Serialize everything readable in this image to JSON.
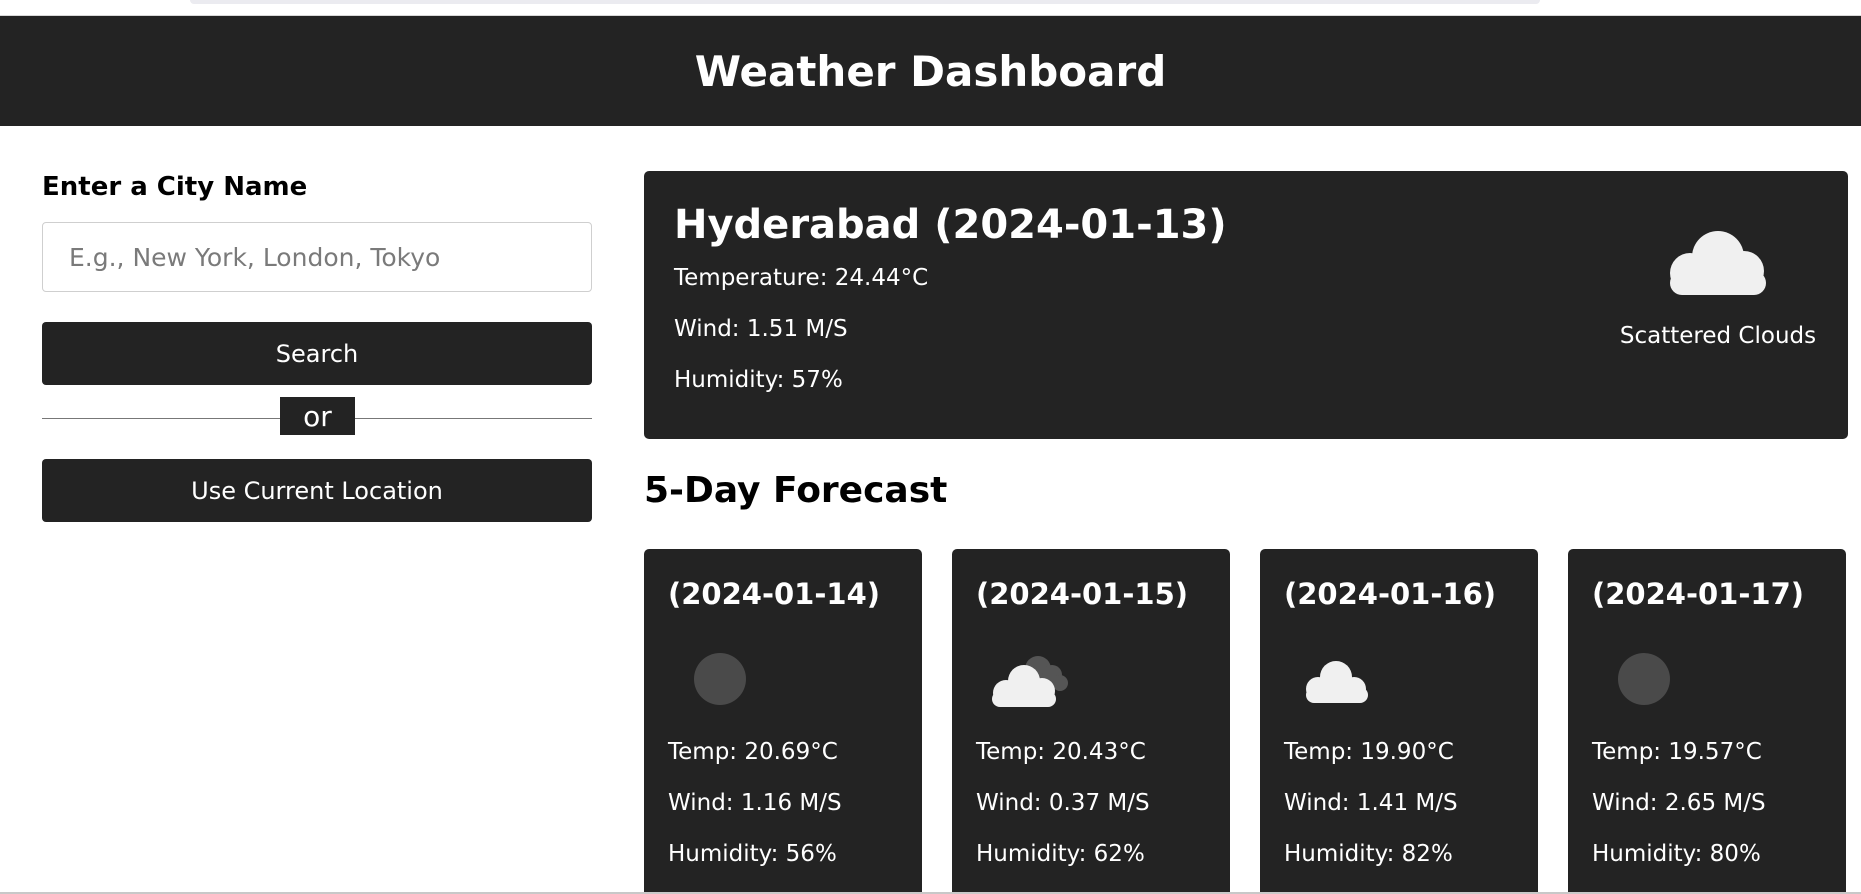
{
  "header": {
    "title": "Weather Dashboard"
  },
  "sidebar": {
    "label": "Enter a City Name",
    "search_placeholder": "E.g., New York, London, Tokyo",
    "search_button": "Search",
    "divider_text": "or",
    "location_button": "Use Current Location"
  },
  "current": {
    "title": "Hyderabad (2024-01-13)",
    "temperature": "Temperature: 24.44°C",
    "wind": "Wind: 1.51 M/S",
    "humidity": "Humidity: 57%",
    "icon": "cloud-icon",
    "description": "Scattered Clouds"
  },
  "forecast": {
    "title": "5-Day Forecast",
    "days": [
      {
        "date": "(2024-01-14)",
        "icon": "clear-night-icon",
        "temp": "Temp: 20.69°C",
        "wind": "Wind: 1.16 M/S",
        "humidity": "Humidity: 56%"
      },
      {
        "date": "(2024-01-15)",
        "icon": "broken-clouds-icon",
        "temp": "Temp: 20.43°C",
        "wind": "Wind: 0.37 M/S",
        "humidity": "Humidity: 62%"
      },
      {
        "date": "(2024-01-16)",
        "icon": "cloud-icon",
        "temp": "Temp: 19.90°C",
        "wind": "Wind: 1.41 M/S",
        "humidity": "Humidity: 82%"
      },
      {
        "date": "(2024-01-17)",
        "icon": "clear-night-icon",
        "temp": "Temp: 19.57°C",
        "wind": "Wind: 2.65 M/S",
        "humidity": "Humidity: 80%"
      }
    ]
  },
  "colors": {
    "dark": "#232323",
    "text_light": "#ffffff",
    "cloud": "#f0f0f0",
    "moon": "#4a4a4a"
  }
}
